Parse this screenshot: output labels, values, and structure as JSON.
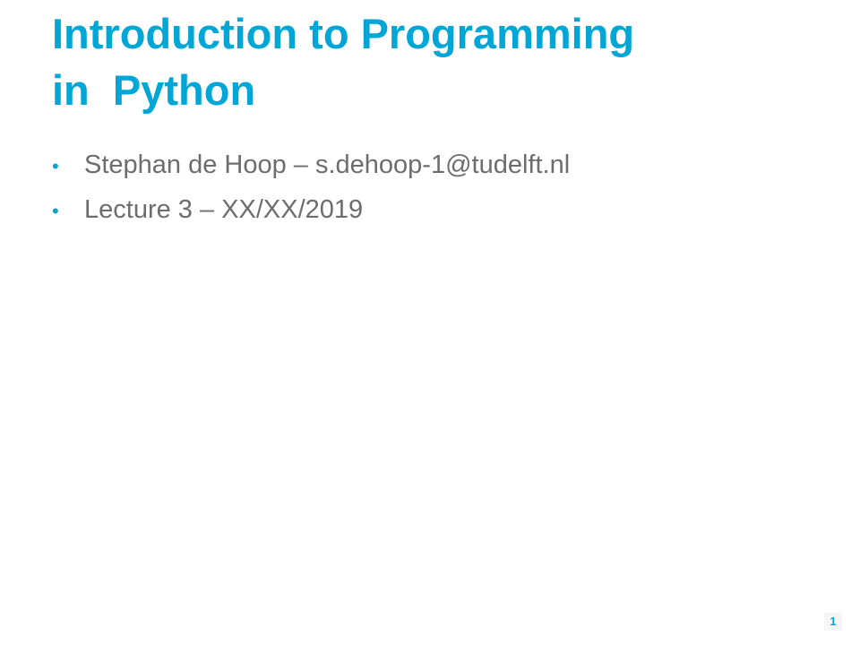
{
  "slide": {
    "title_lines": [
      "Introduction to Programming",
      "in  Python"
    ],
    "bullets": [
      "Stephan de Hoop – s.dehoop-1@tudelft.nl",
      "Lecture 3 – XX/XX/2019"
    ],
    "bullet_glyph": "•",
    "slide_number": "1"
  },
  "colors": {
    "title": "#00a6d6",
    "bullet_marker": "#00a6d6",
    "body_text": "#6d6d6d",
    "background": "#ffffff"
  }
}
